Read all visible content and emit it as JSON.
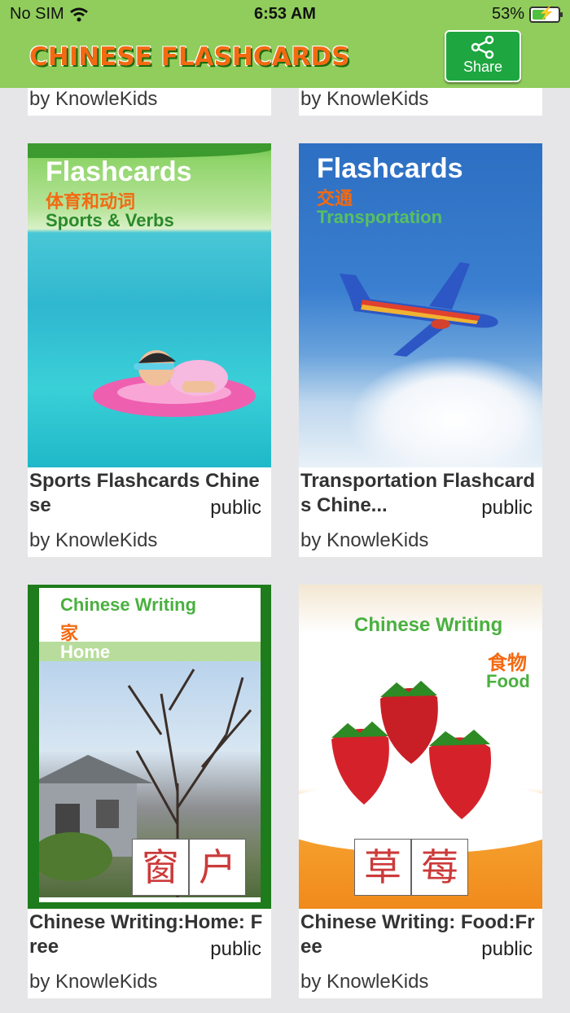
{
  "status_bar": {
    "carrier": "No SIM",
    "time": "6:53 AM",
    "battery": "53%",
    "battery_level": 0.53
  },
  "header": {
    "logo_text": "CHINESE FLASHCARDS",
    "share_label": "Share"
  },
  "top_cards": [
    {
      "byline": "by KnowleKids"
    },
    {
      "byline": "by KnowleKids"
    }
  ],
  "cards": [
    {
      "title": "Sports Flashcards Chinese",
      "visibility": "public",
      "byline": "by KnowleKids",
      "cover": {
        "heading": "Flashcards",
        "chinese": "体育和动词",
        "english": "Sports & Verbs"
      }
    },
    {
      "title": "Transportation Flashcards Chine...",
      "visibility": "public",
      "byline": "by KnowleKids",
      "cover": {
        "heading": "Flashcards",
        "chinese": "交通",
        "english": "Transportation"
      }
    },
    {
      "title": "Chinese Writing:Home: Free",
      "visibility": "public",
      "byline": "by KnowleKids",
      "cover": {
        "heading": "Chinese Writing",
        "chinese": "家",
        "english": "Home",
        "chars": [
          "窗",
          "户"
        ]
      }
    },
    {
      "title": "Chinese Writing: Food:Free",
      "visibility": "public",
      "byline": "by KnowleKids",
      "cover": {
        "heading": "Chinese Writing",
        "chinese": "食物",
        "english": "Food",
        "chars": [
          "草",
          "莓"
        ]
      }
    }
  ],
  "colors": {
    "header_bg": "#90cd5c",
    "share_bg": "#1ea640",
    "logo": "#f36a12",
    "page_bg": "#e6e6e8"
  }
}
